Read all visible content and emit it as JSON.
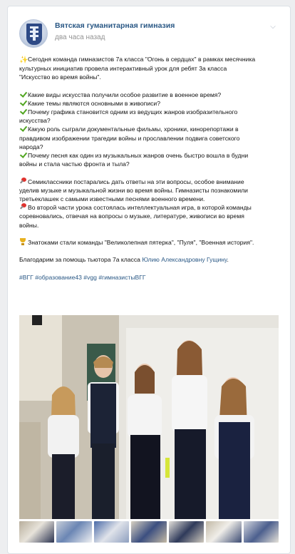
{
  "post": {
    "group_name": "Вятская гуманитарная гимназия",
    "time": "два часа назад",
    "intro": [
      "Сегодня команда гимназистов 7а класса \"Огонь в сердцах\" в рамках месячника",
      "культурных инициатив провела интерактивный урок для ребят 3а класса",
      "\"Искусство во время войны\"."
    ],
    "questions": [
      [
        "Какие виды искусства получили особое развитие в военное время?"
      ],
      [
        "Какие темы являются основными в живописи?"
      ],
      [
        "Почему графика становится одним из ведущих жанров изобразительного",
        "искусства?"
      ],
      [
        "Какую роль сыграли документальные фильмы, хроники, кинорепортажи в",
        "правдивом изображении трагедии войны и прославлении подвига советского",
        "народа?"
      ],
      [
        "Почему песня как один из музыкальных жанров очень быстро вошла в будни",
        "войны и стала частью фронта и тыла?"
      ]
    ],
    "para2": [
      "Семиклассники постарались дать ответы на эти вопросы, особое внимание",
      "уделив музыке и музыкальной жизни во время войны. Гимназисты познакомили",
      "третьеклашек с самыми известными песнями военного времени."
    ],
    "para3": [
      "Во второй части урока состоялась интеллектуальная игра, в которой команды",
      "соревновались, отвечая на вопросы о музыке, литературе, живописи во время",
      "войны."
    ],
    "winners": "Знатоками стали команды \"Великолепная пятерка\", \"Пуля\", \"Военная история\".",
    "thanks_prefix": "Благодарим за помощь тьютора 7а класса ",
    "thanks_link": "Юлию Александровну Гущину",
    "thanks_suffix": ".",
    "hashtags": "#ВГГ #образование43 #vgg #гимназистыВГГ"
  },
  "icons": {
    "sparkle": "sparkles-icon",
    "check": "check-mark-icon",
    "pin": "pushpin-icon",
    "trophy": "trophy-icon",
    "menu": "chevron-down-icon"
  },
  "colors": {
    "link": "#2a5885",
    "check": "#51a520",
    "pin": "#e0322e",
    "time": "#939393"
  },
  "gallery": {
    "thumb_count": 7
  }
}
